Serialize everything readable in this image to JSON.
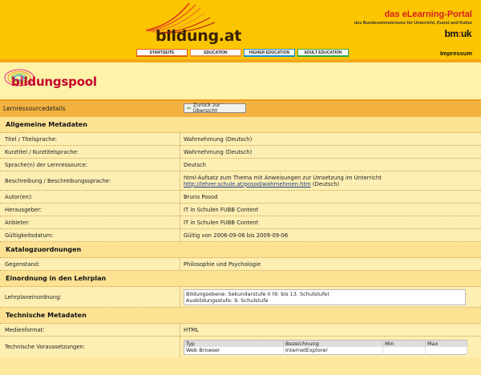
{
  "header": {
    "logo_text": "bildung.at",
    "portal_title": "das eLearning-Portal",
    "portal_subtitle": "des Bundesministeriums für Unterricht, Kunst und Kultur",
    "ministry_logo": "bm:uk",
    "nav": [
      "STARTSEITE",
      "EDUCATION",
      "HIGHER EDUCATION",
      "ADULT EDUCATION"
    ],
    "impressum": "Impressum",
    "colors": {
      "header_bg": "#fcc501",
      "nav_red": "#e25d10",
      "nav_blue": "#1a8fc9",
      "nav_green": "#2da64c",
      "portal_red": "#d62020"
    }
  },
  "pool": {
    "logo_text": "bildungspool",
    "logo_color": "#c4002f"
  },
  "titlebar": {
    "title": "Lernressourcedetails",
    "back_button": "Zurück zur Übersicht"
  },
  "sections": {
    "general": {
      "heading": "Allgemeine Metadaten",
      "rows": [
        {
          "label": "Titel / Titelsprache:",
          "value": "Wahrnehmung (Deutsch)"
        },
        {
          "label": "Kurztitel / Kurztitelsprache:",
          "value": "Wahrnehmung (Deutsch)"
        },
        {
          "label": "Sprache(n) der Lernressource:",
          "value": "Deutsch"
        },
        {
          "label": "Beschreibung / Beschreibungssprache:",
          "value": "html-Aufsatz zum Thema mit Anweisungen zur Umsetzung im Unterricht",
          "link": "http://lehrer.schule.at/posod/wahrnehmen.htm",
          "link_suffix": " (Deutsch)"
        },
        {
          "label": "Autor(en):",
          "value": "Bruno Posod"
        },
        {
          "label": "Herausgeber:",
          "value": "IT in Schulen FUBB Content"
        },
        {
          "label": "Anbieter:",
          "value": "IT in Schulen FUBB Content"
        },
        {
          "label": "Gültigkeitsdatum:",
          "value": "Gültig von 2006-09-06 bis 2009-09-06"
        }
      ]
    },
    "catalog": {
      "heading": "Katalogzuordnungen",
      "rows": [
        {
          "label": "Gegenstand:",
          "value": "Philosophie und Psychologie"
        }
      ]
    },
    "curriculum": {
      "heading": "Einordnung in den Lehrplan",
      "label": "Lehrplaneinordnung:",
      "lines": [
        "Bildungsebene: Sekundarstufe II (9. bis 13. Schulstufe)",
        "Ausbildungsstufe: 9. Schulstufe"
      ]
    },
    "technical": {
      "heading": "Technische Metadaten",
      "media_label": "Medienformat:",
      "media_value": "HTML",
      "req_label": "Technische Voraussetzungen:",
      "table_headers": [
        "Typ",
        "Bezeichnung",
        "Min",
        "Max"
      ],
      "table_rows": [
        [
          "Web Browser",
          "InternetExplorer",
          "",
          ""
        ]
      ]
    }
  }
}
